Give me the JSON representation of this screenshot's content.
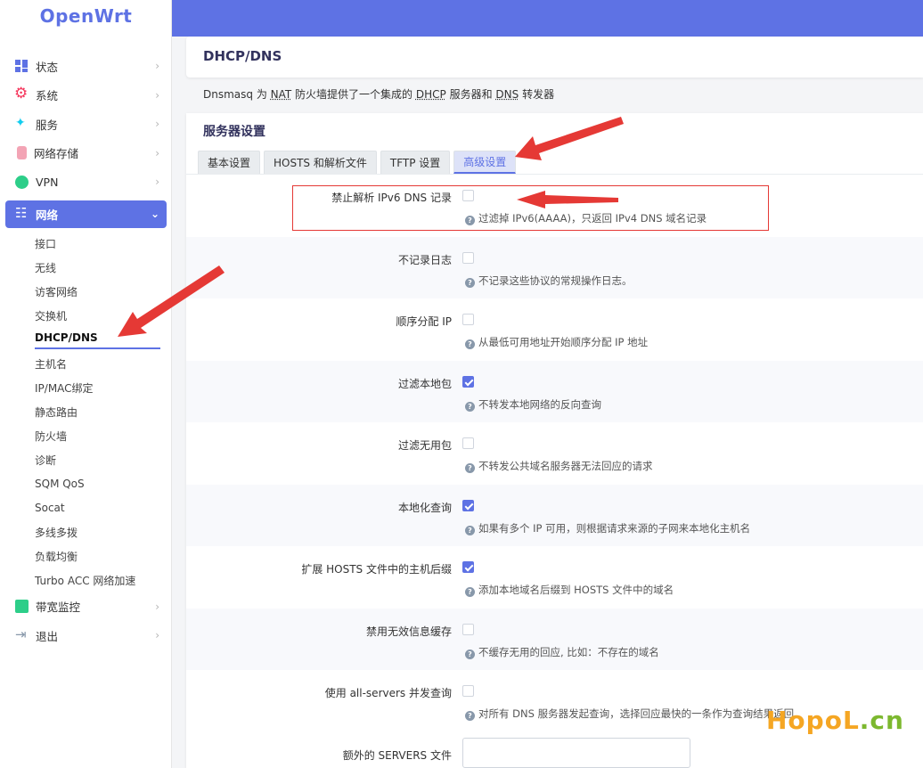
{
  "brand": "OpenWrt",
  "sidebar": {
    "items_top": [
      {
        "label": "状态",
        "icon": "dashboard-icon"
      },
      {
        "label": "系统",
        "icon": "gear-icon"
      },
      {
        "label": "服务",
        "icon": "services-icon"
      },
      {
        "label": "网络存储",
        "icon": "storage-icon"
      },
      {
        "label": "VPN",
        "icon": "vpn-icon"
      }
    ],
    "active": {
      "label": "网络",
      "icon": "network-icon"
    },
    "sub_items": [
      "接口",
      "无线",
      "访客网络",
      "交换机",
      "DHCP/DNS",
      "主机名",
      "IP/MAC绑定",
      "静态路由",
      "防火墙",
      "诊断",
      "SQM QoS",
      "Socat",
      "多线多拨",
      "负载均衡",
      "Turbo ACC 网络加速"
    ],
    "current_sub": "DHCP/DNS",
    "items_bottom": [
      {
        "label": "带宽监控",
        "icon": "bandwidth-icon"
      },
      {
        "label": "退出",
        "icon": "logout-icon"
      }
    ]
  },
  "page": {
    "title": "DHCP/DNS",
    "desc_parts": [
      "Dnsmasq 为 ",
      "NAT",
      " 防火墙提供了一个集成的 ",
      "DHCP",
      " 服务器和 ",
      "DNS",
      " 转发器"
    ]
  },
  "section": {
    "title": "服务器设置",
    "tabs": [
      "基本设置",
      "HOSTS 和解析文件",
      "TFTP 设置",
      "高级设置"
    ],
    "active_tab": "高级设置"
  },
  "options": [
    {
      "label": "禁止解析 IPv6 DNS 记录",
      "checked": false,
      "hint": "过滤掉 IPv6(AAAA)，只返回 IPv4 DNS 域名记录"
    },
    {
      "label": "不记录日志",
      "checked": false,
      "hint": "不记录这些协议的常规操作日志。"
    },
    {
      "label": "顺序分配 IP",
      "checked": false,
      "hint": "从最低可用地址开始顺序分配 IP 地址"
    },
    {
      "label": "过滤本地包",
      "checked": true,
      "hint": "不转发本地网络的反向查询"
    },
    {
      "label": "过滤无用包",
      "checked": false,
      "hint": "不转发公共域名服务器无法回应的请求"
    },
    {
      "label": "本地化查询",
      "checked": true,
      "hint": "如果有多个 IP 可用，则根据请求来源的子网来本地化主机名"
    },
    {
      "label": "扩展 HOSTS 文件中的主机后缀",
      "checked": true,
      "hint": "添加本地域名后缀到 HOSTS 文件中的域名"
    },
    {
      "label": "禁用无效信息缓存",
      "checked": false,
      "hint": "不缓存无用的回应, 比如：不存在的域名"
    },
    {
      "label": "使用 all-servers 并发查询",
      "checked": false,
      "hint": "对所有 DNS 服务器发起查询，选择回应最快的一条作为查询结果返回"
    }
  ],
  "servers_file": {
    "label": "额外的 SERVERS 文件",
    "value": ""
  },
  "watermark": {
    "part1": "HopoL",
    "part2": ".cn"
  },
  "colors": {
    "accent": "#5e72e4",
    "annotation": "#e53935"
  }
}
